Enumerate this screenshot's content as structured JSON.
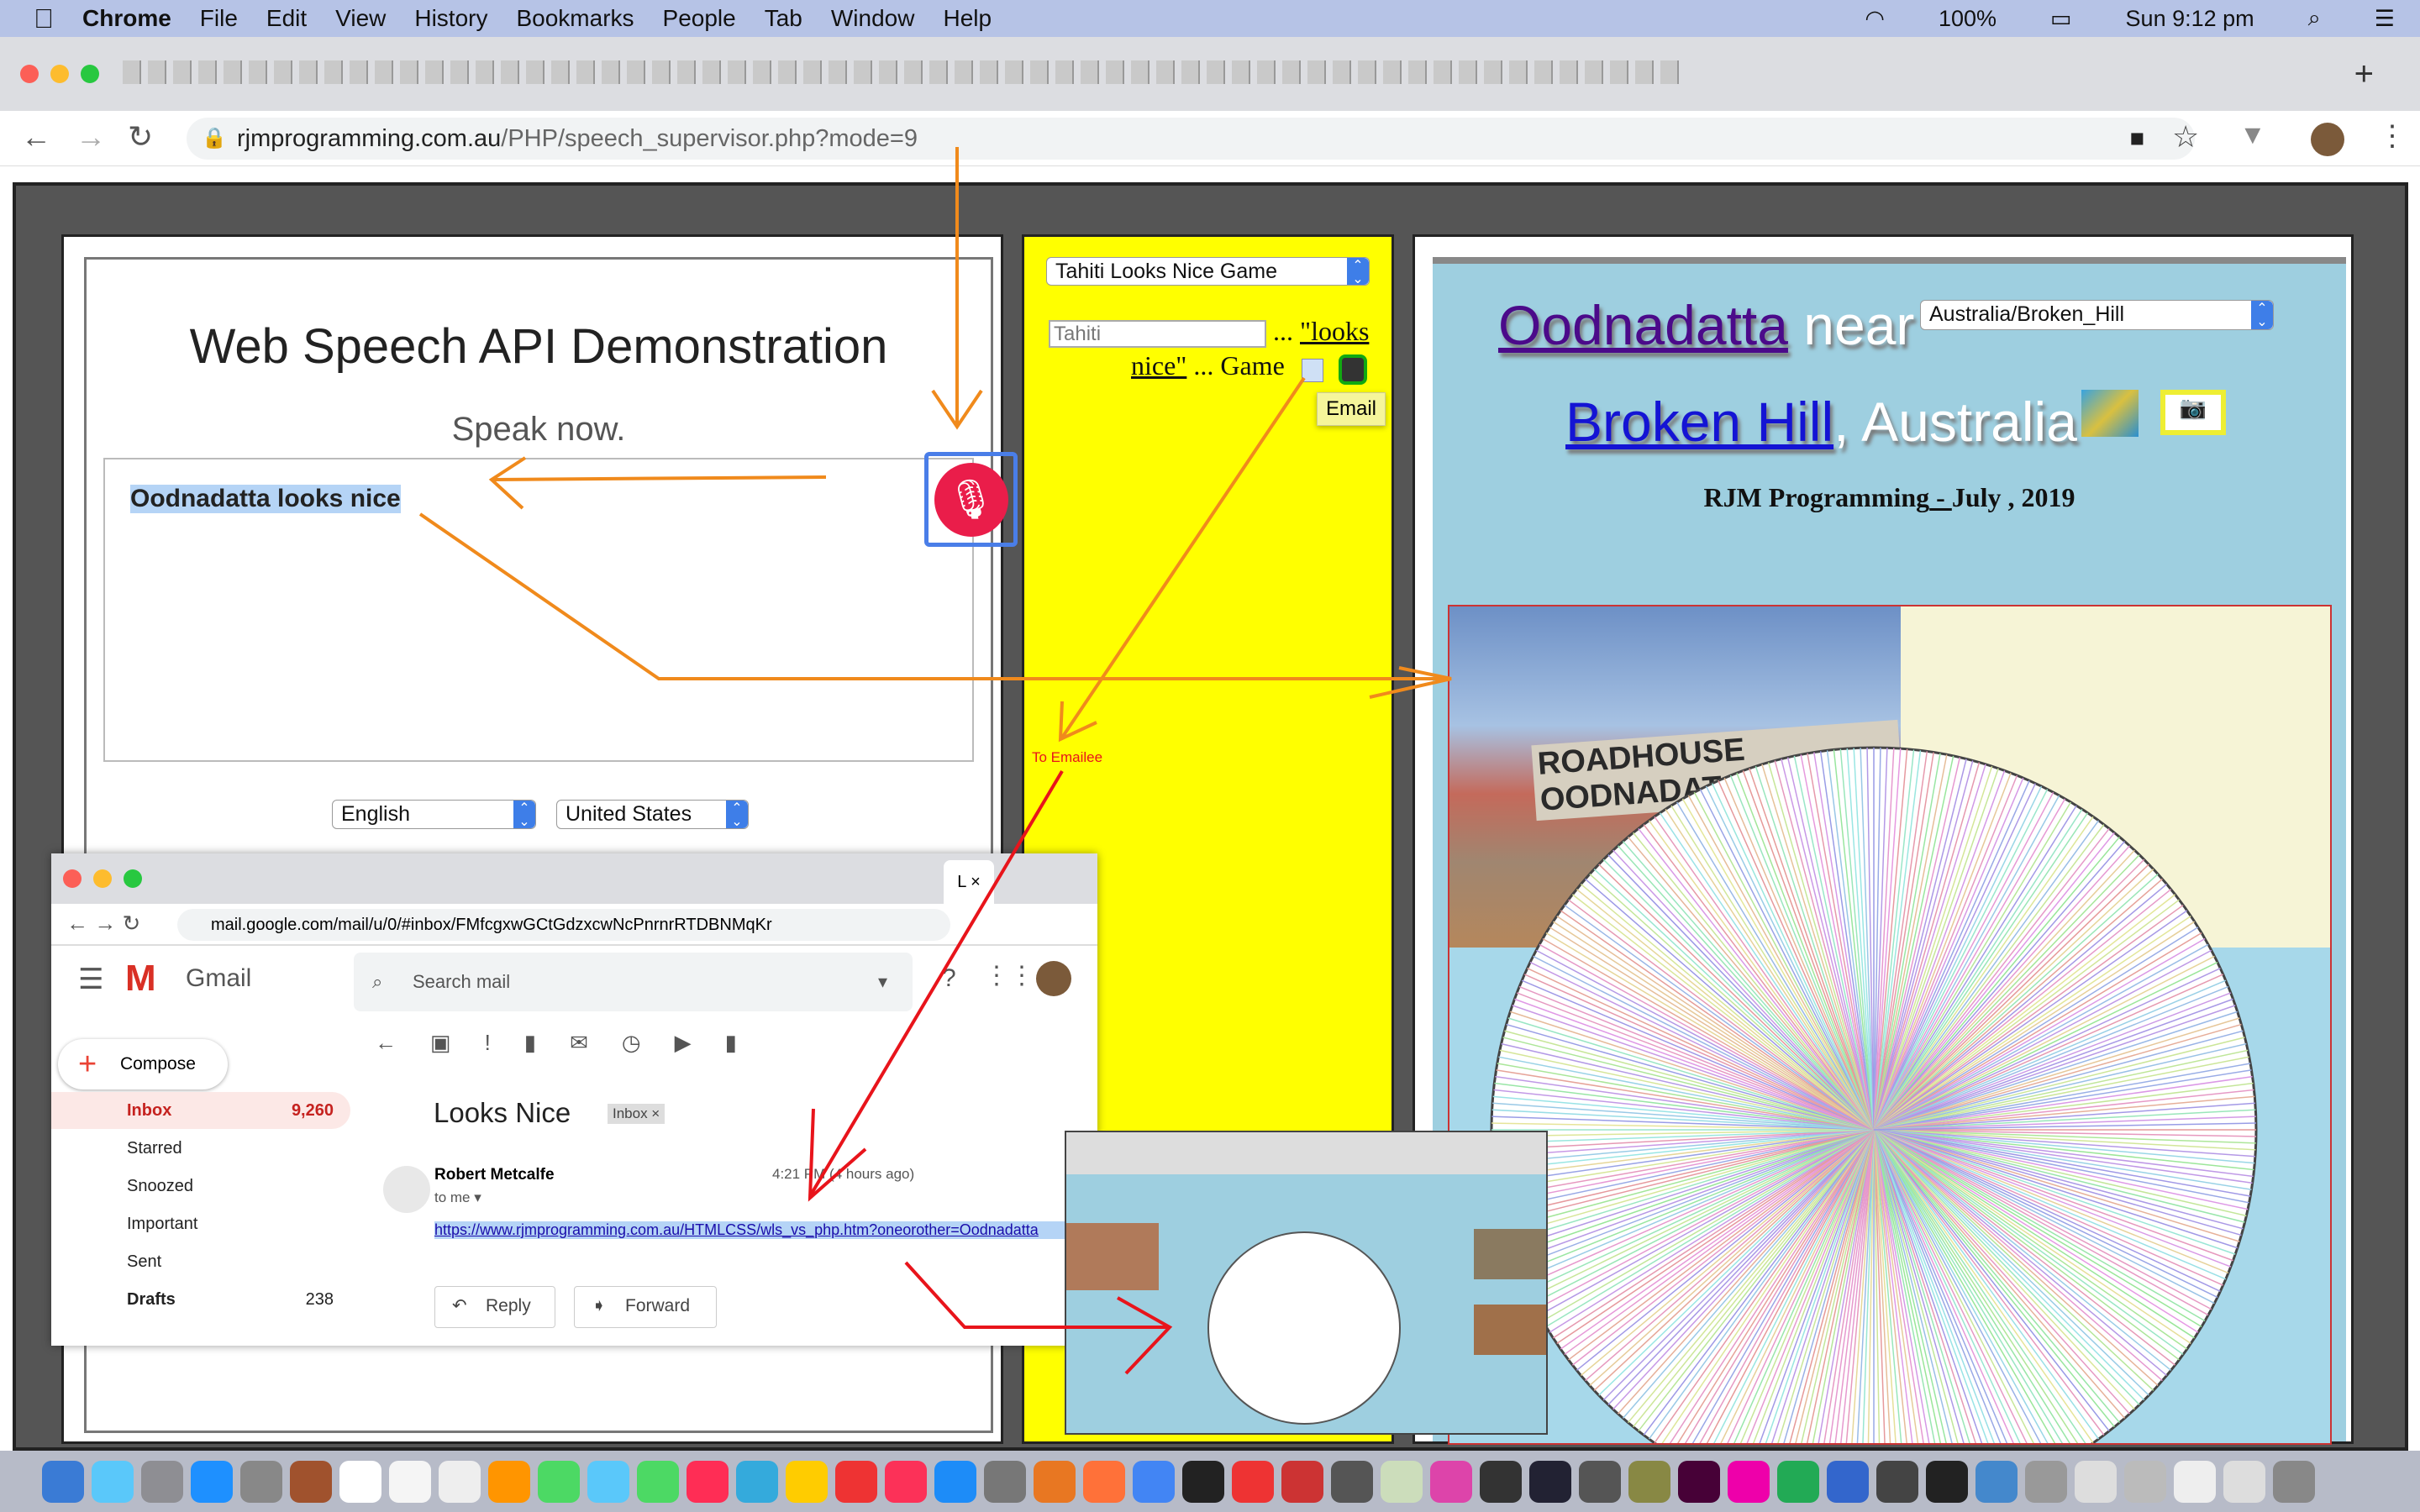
{
  "menubar": {
    "app": "Chrome",
    "items": [
      "File",
      "Edit",
      "View",
      "History",
      "Bookmarks",
      "People",
      "Tab",
      "Window",
      "Help"
    ],
    "battery": "100%",
    "clock": "Sun 9:12 pm"
  },
  "browser": {
    "url_host": "rjmprogramming.com.au",
    "url_path": "/PHP/speech_supervisor.php?mode=9",
    "new_tab": "+"
  },
  "speech": {
    "title_a": "Web Speech API",
    "title_b": " Demonstration",
    "prompt": "Speak now.",
    "transcript": "Oodnadatta looks nice",
    "language": "English",
    "dialect": "United States"
  },
  "game": {
    "select": "Tahiti Looks Nice Game",
    "input_value": "Tahiti",
    "text1": " ... ",
    "link1": "\"looks",
    "link2": "nice\"",
    "text2": " ... Game",
    "tooltip": "Email",
    "annotation": "To Emailee"
  },
  "place": {
    "town": "Oodnadatta",
    "near": " near",
    "timezone": "Australia/Broken_Hill",
    "city": "Broken Hill",
    "country": ", Australia",
    "credit": "RJM Programming",
    "dash": " - ",
    "date": "July , 2019",
    "photo_sign": "ROADHOUSE OODNADAT"
  },
  "gmail": {
    "url": "mail.google.com/mail/u/0/#inbox/FMfcgxwGCtGdzxcwNcPnrnrRTDBNMqKr",
    "logo": "Gmail",
    "search_placeholder": "Search mail",
    "compose": "Compose",
    "nav": [
      {
        "label": "Inbox",
        "count": "9,260"
      },
      {
        "label": "Starred"
      },
      {
        "label": "Snoozed"
      },
      {
        "label": "Important"
      },
      {
        "label": "Sent"
      },
      {
        "label": "Drafts",
        "count": "238"
      }
    ],
    "subject": "Looks Nice",
    "label_chip": "Inbox ×",
    "sender": "Robert Metcalfe",
    "to": "to me ▾",
    "time": "4:21 PM (4 hours ago)",
    "body_link": "https://www.rjmprogramming.com.au/HTMLCSS/wls_vs_php.htm?oneorother=Oodnadatta",
    "reply": "Reply",
    "forward": "Forward"
  },
  "colors": {
    "annotation_orange": "#f08a1c",
    "annotation_red": "#e8141b",
    "yellow_panel": "#ffff00",
    "map_blue": "#9ecfe0",
    "mic_red": "#ea1d4a"
  }
}
